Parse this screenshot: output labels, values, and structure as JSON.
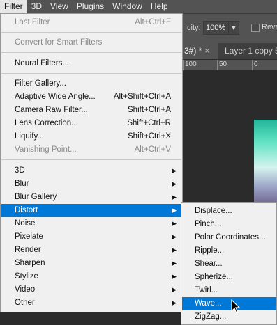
{
  "menubar": {
    "items": [
      "Filter",
      "3D",
      "View",
      "Plugins",
      "Window",
      "Help"
    ],
    "active": "Filter"
  },
  "options": {
    "opacity_label": "city:",
    "opacity_value": "100%",
    "reverse_label": "Reve"
  },
  "tabs": [
    {
      "label": "3#) *",
      "close": "×"
    },
    {
      "label": "Layer 1 copy 5"
    }
  ],
  "ruler": [
    "100",
    "50",
    "0"
  ],
  "filter_menu": {
    "last_filter": {
      "label": "Last Filter",
      "shortcut": "Alt+Ctrl+F"
    },
    "convert_smart": "Convert for Smart Filters",
    "neural": "Neural Filters...",
    "group1": [
      {
        "label": "Filter Gallery...",
        "shortcut": "",
        "disabled": false
      },
      {
        "label": "Adaptive Wide Angle...",
        "shortcut": "Alt+Shift+Ctrl+A",
        "disabled": false
      },
      {
        "label": "Camera Raw Filter...",
        "shortcut": "Shift+Ctrl+A",
        "disabled": false
      },
      {
        "label": "Lens Correction...",
        "shortcut": "Shift+Ctrl+R",
        "disabled": false
      },
      {
        "label": "Liquify...",
        "shortcut": "Shift+Ctrl+X",
        "disabled": false
      },
      {
        "label": "Vanishing Point...",
        "shortcut": "Alt+Ctrl+V",
        "disabled": true
      }
    ],
    "submenus": [
      "3D",
      "Blur",
      "Blur Gallery",
      "Distort",
      "Noise",
      "Pixelate",
      "Render",
      "Sharpen",
      "Stylize",
      "Video",
      "Other"
    ],
    "highlighted": "Distort",
    "arrow": "▶"
  },
  "distort_submenu": {
    "items": [
      "Displace...",
      "Pinch...",
      "Polar Coordinates...",
      "Ripple...",
      "Shear...",
      "Spherize...",
      "Twirl...",
      "Wave...",
      "ZigZag..."
    ],
    "highlighted": "Wave..."
  },
  "icons": {
    "dropdown_arrow": "chevron-down-icon",
    "cursor": "arrow-cursor-icon"
  },
  "colors": {
    "highlight": "#0078d7",
    "menu_bg": "#f0f0f0",
    "menubar_bg": "#535353"
  }
}
